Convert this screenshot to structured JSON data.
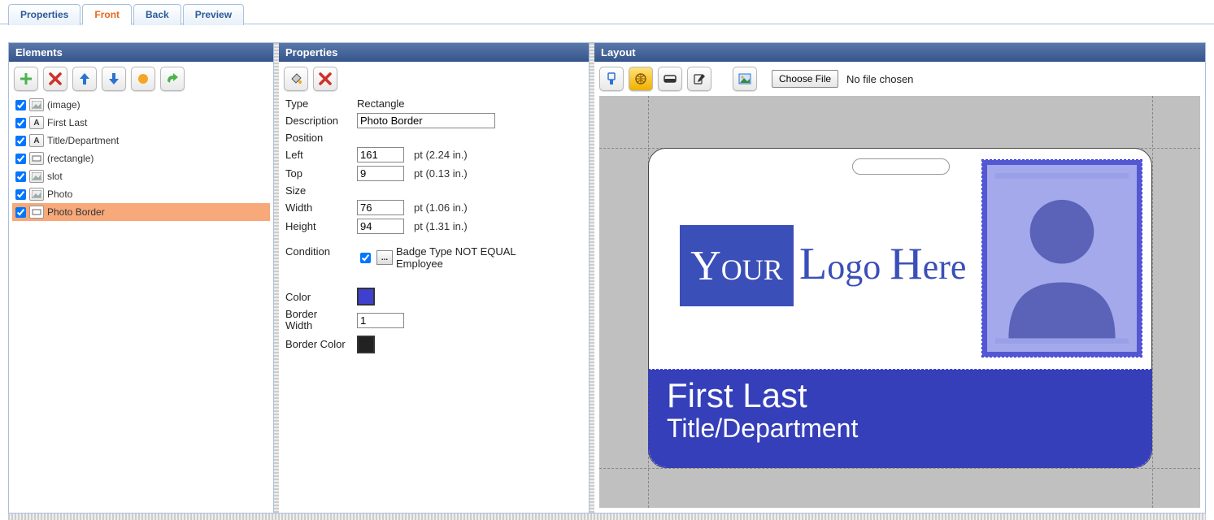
{
  "tabs": {
    "properties": "Properties",
    "front": "Front",
    "back": "Back",
    "preview": "Preview",
    "active": "front"
  },
  "panels": {
    "elements_title": "Elements",
    "properties_title": "Properties",
    "layout_title": "Layout"
  },
  "elements": {
    "items": [
      {
        "label": "(image)",
        "icon": "image"
      },
      {
        "label": "First Last",
        "icon": "text"
      },
      {
        "label": "Title/Department",
        "icon": "text"
      },
      {
        "label": "(rectangle)",
        "icon": "rect"
      },
      {
        "label": "slot",
        "icon": "image"
      },
      {
        "label": "Photo",
        "icon": "image"
      },
      {
        "label": "Photo Border",
        "icon": "rect"
      }
    ],
    "selected_index": 6
  },
  "properties": {
    "type": {
      "label": "Type",
      "value": "Rectangle"
    },
    "description": {
      "label": "Description",
      "value": "Photo Border"
    },
    "position_label": "Position",
    "left": {
      "label": "Left",
      "value": "161",
      "unit": "pt (2.24 in.)"
    },
    "top": {
      "label": "Top",
      "value": "9",
      "unit": "pt (0.13 in.)"
    },
    "size_label": "Size",
    "width": {
      "label": "Width",
      "value": "76",
      "unit": "pt (1.06 in.)"
    },
    "height": {
      "label": "Height",
      "value": "94",
      "unit": "pt (1.31 in.)"
    },
    "condition": {
      "label": "Condition",
      "checked": true,
      "text": "Badge Type NOT EQUAL Employee"
    },
    "color": {
      "label": "Color",
      "value": "#4040d0"
    },
    "border_width": {
      "label": "Border Width",
      "value": "1"
    },
    "border_color": {
      "label": "Border Color",
      "value": "#222222"
    }
  },
  "layout": {
    "file_button": "Choose File",
    "file_status": "No file chosen",
    "card": {
      "logo_your": "YOUR",
      "logo_rest": "Logo Here",
      "first_last": "First Last",
      "department": "Title/Department"
    }
  },
  "icons": {
    "add": "add",
    "delete": "delete",
    "up": "up",
    "down": "down",
    "front": "front",
    "back": "back",
    "paint": "paint",
    "conn": "conn",
    "badge": "badge",
    "landscape": "landscape",
    "portrait": "portrait",
    "image": "image"
  }
}
